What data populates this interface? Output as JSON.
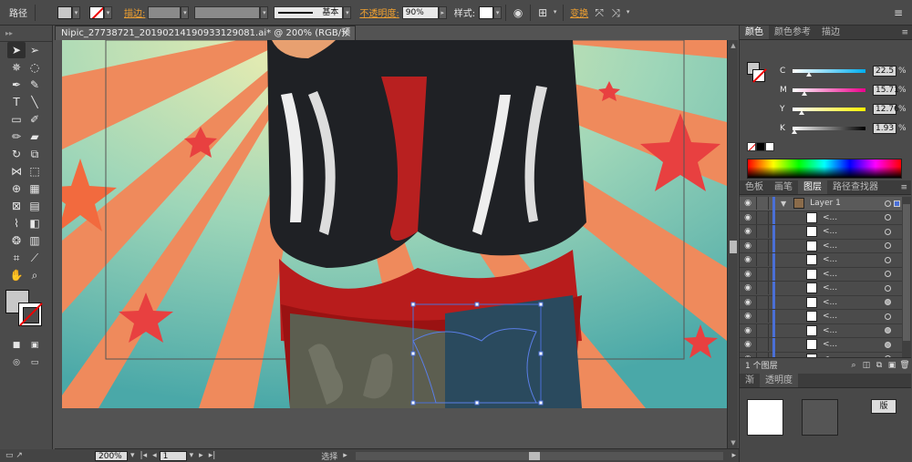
{
  "control_bar": {
    "object_type": "路径",
    "stroke_label": "描边",
    "stroke_colon": ":",
    "stroke_profile": "基本",
    "opacity_label": "不透明度",
    "opacity_colon": ":",
    "opacity_value": "90%",
    "style_label": "样式",
    "style_colon": ":",
    "transform_label": "变换"
  },
  "document": {
    "tab_title": "Nipic_27738721_20190214190933129081.ai* @ 200% (RGB/预览)",
    "close_glyph": "×"
  },
  "status": {
    "zoom": "200%",
    "page": "1",
    "tool_status": "选择"
  },
  "color_panel": {
    "tabs": [
      "颜色",
      "颜色参考",
      "描边"
    ],
    "channels": [
      {
        "name": "C",
        "value": "22.5",
        "unit": "%",
        "gradient": "linear-gradient(to right,#fff,#00aeef)",
        "fraction": 0.225
      },
      {
        "name": "M",
        "value": "15.71",
        "unit": "%",
        "gradient": "linear-gradient(to right,#fff,#ec008c)",
        "fraction": 0.157
      },
      {
        "name": "Y",
        "value": "12.76",
        "unit": "%",
        "gradient": "linear-gradient(to right,#fff,#fff200)",
        "fraction": 0.128
      },
      {
        "name": "K",
        "value": "1.93",
        "unit": "%",
        "gradient": "linear-gradient(to right,#fff,#000)",
        "fraction": 0.019
      }
    ]
  },
  "layers_panel": {
    "tabs": [
      "色板",
      "画笔",
      "图层",
      "路径查找器"
    ],
    "layer_name": "Layer 1",
    "sublayer_label": "<...",
    "sublayer_count": 11,
    "footer_count": "1 个图层"
  },
  "bottom_panel": {
    "tabs": [
      "渐",
      "透明度"
    ],
    "button_label": "版"
  },
  "colors": {
    "accent_orange": "#f0a030",
    "selection_blue": "#4a6fd6",
    "panel_bg": "#4b4b4b"
  }
}
